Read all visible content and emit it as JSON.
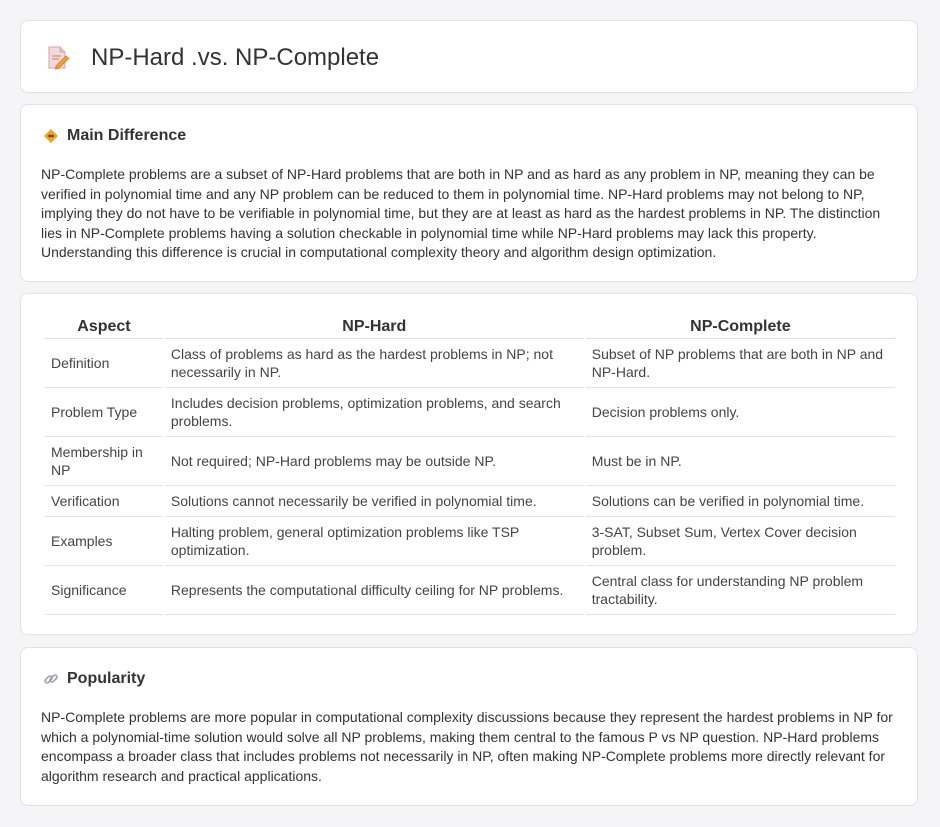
{
  "header": {
    "title": "NP-Hard .vs. NP-Complete",
    "icon": "document-pencil-icon"
  },
  "main_difference": {
    "icon": "diamond-arrows-icon",
    "heading": "Main Difference",
    "text": "NP-Complete problems are a subset of NP-Hard problems that are both in NP and as hard as any problem in NP, meaning they can be verified in polynomial time and any NP problem can be reduced to them in polynomial time. NP-Hard problems may not belong to NP, implying they do not have to be verifiable in polynomial time, but they are at least as hard as the hardest problems in NP. The distinction lies in NP-Complete problems having a solution checkable in polynomial time while NP-Hard problems may lack this property. Understanding this difference is crucial in computational complexity theory and algorithm design optimization."
  },
  "comparison": {
    "headers": [
      "Aspect",
      "NP-Hard",
      "NP-Complete"
    ],
    "rows": [
      [
        "Definition",
        "Class of problems as hard as the hardest problems in NP; not necessarily in NP.",
        "Subset of NP problems that are both in NP and NP-Hard."
      ],
      [
        "Problem Type",
        "Includes decision problems, optimization problems, and search problems.",
        "Decision problems only."
      ],
      [
        "Membership in NP",
        "Not required; NP-Hard problems may be outside NP.",
        "Must be in NP."
      ],
      [
        "Verification",
        "Solutions cannot necessarily be verified in polynomial time.",
        "Solutions can be verified in polynomial time."
      ],
      [
        "Examples",
        "Halting problem, general optimization problems like TSP optimization.",
        "3-SAT, Subset Sum, Vertex Cover decision problem."
      ],
      [
        "Significance",
        "Represents the computational difficulty ceiling for NP problems.",
        "Central class for understanding NP problem tractability."
      ]
    ]
  },
  "popularity": {
    "icon": "link-icon",
    "heading": "Popularity",
    "text": "NP-Complete problems are more popular in computational complexity discussions because they represent the hardest problems in NP for which a polynomial-time solution would solve all NP problems, making them central to the famous P vs NP question. NP-Hard problems encompass a broader class that includes problems not necessarily in NP, often making NP-Complete problems more directly relevant for algorithm research and practical applications."
  },
  "colors": {
    "page_background": "#f5f5f7",
    "card_background": "#ffffff",
    "accent_orange": "#f0a030",
    "icon_pink": "#e8768a"
  }
}
